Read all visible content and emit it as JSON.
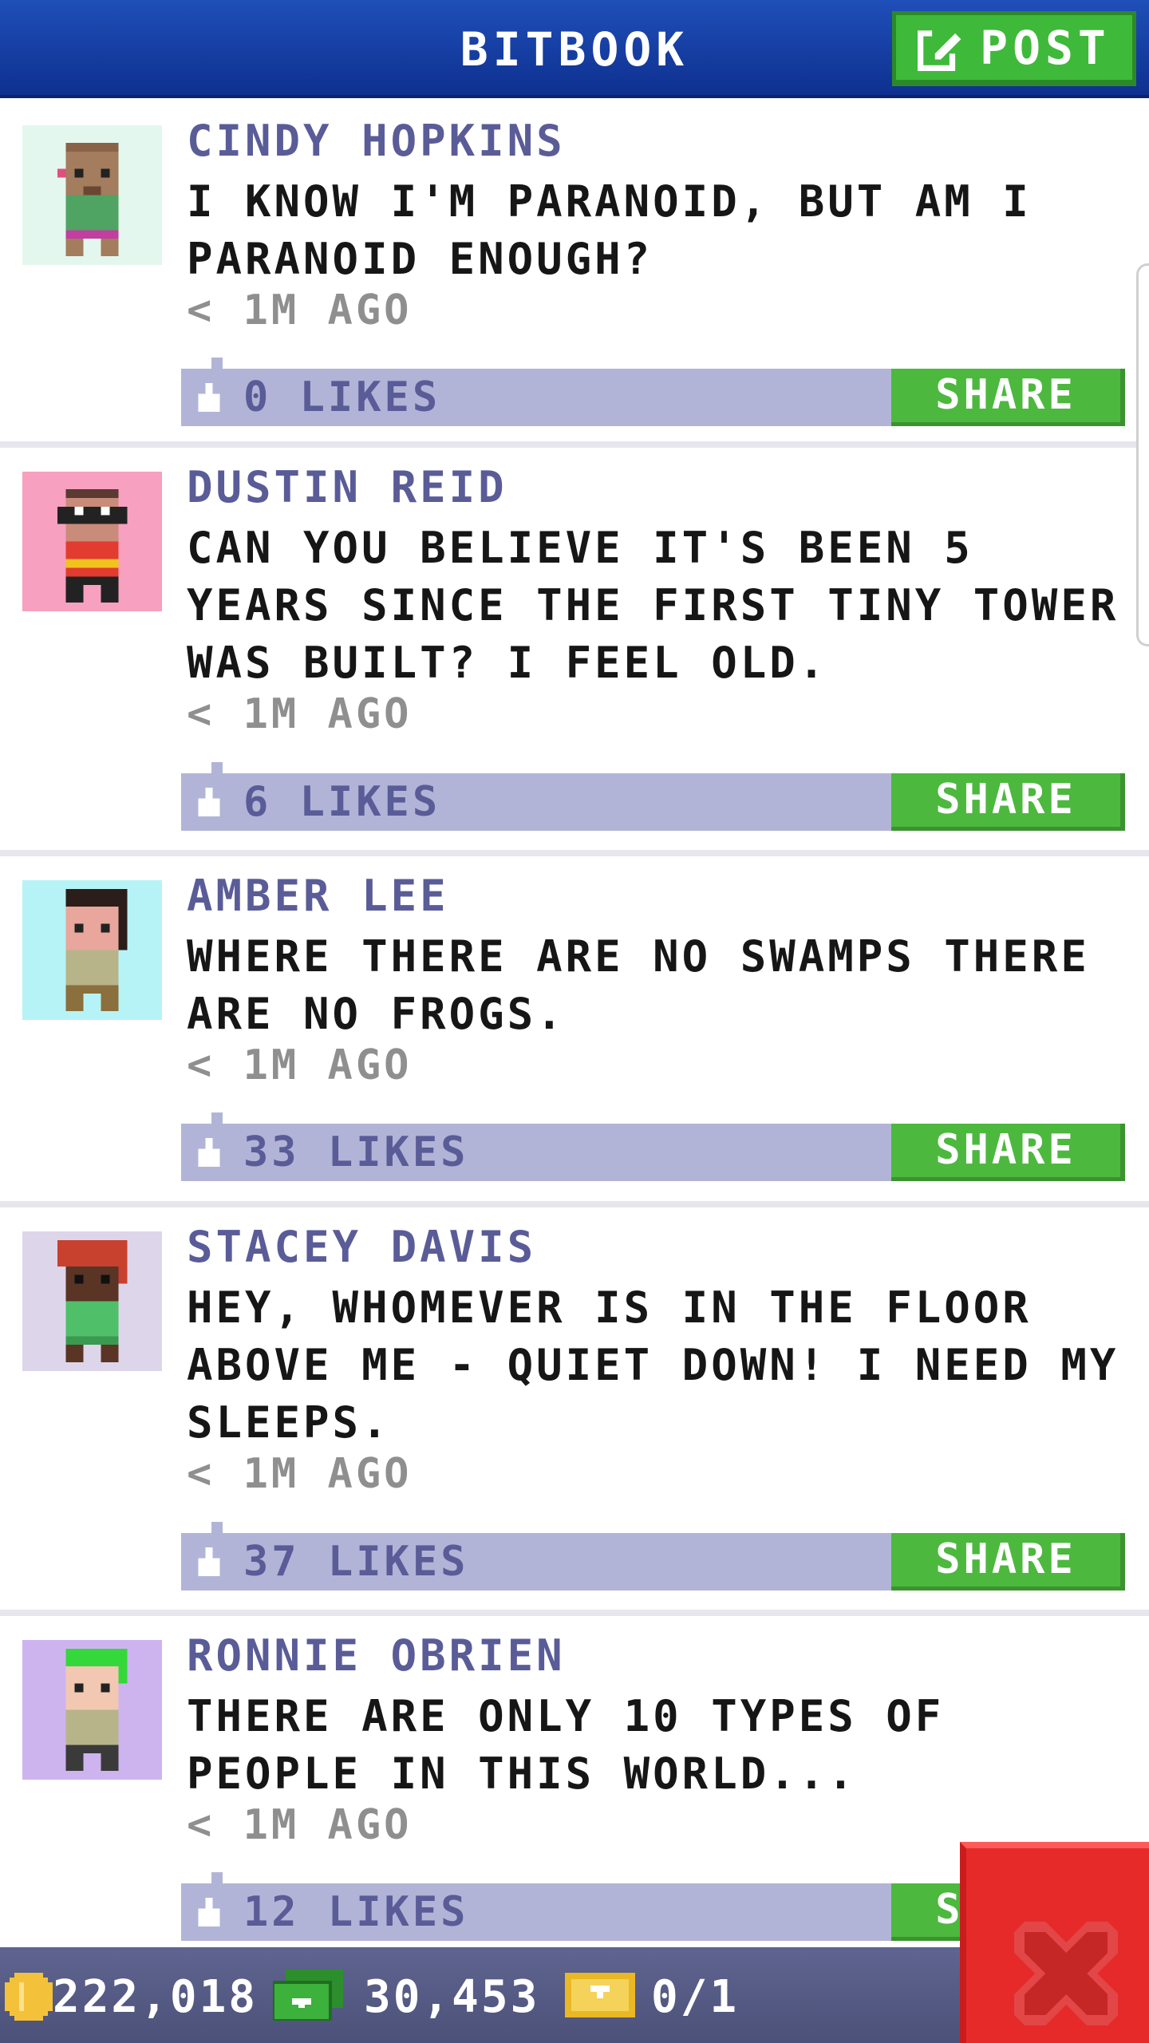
{
  "header": {
    "title": "BITBOOK",
    "post_label": "POST"
  },
  "colors": {
    "header": "#1a45a8",
    "accent_green": "#3fb93a",
    "likes_bar": "#b2b4d7",
    "author": "#5a5c98",
    "close": "#e62a2a"
  },
  "posts": [
    {
      "author": "CINDY HOPKINS",
      "text": "I KNOW I'M PARANOID, BUT AM I PARANOID ENOUGH?",
      "time": "< 1M AGO",
      "likes": "0 LIKES",
      "share": "SHARE",
      "avatar_bg": "#e3f7ee"
    },
    {
      "author": "DUSTIN REID",
      "text": "CAN YOU BELIEVE IT'S BEEN 5 YEARS SINCE THE FIRST TINY TOWER WAS BUILT? I FEEL OLD.",
      "time": "< 1M AGO",
      "likes": "6 LIKES",
      "share": "SHARE",
      "avatar_bg": "#f7a0c0"
    },
    {
      "author": "AMBER LEE",
      "text": "WHERE THERE ARE NO SWAMPS THERE ARE NO FROGS.",
      "time": "< 1M AGO",
      "likes": "33 LIKES",
      "share": "SHARE",
      "avatar_bg": "#b6f3f6"
    },
    {
      "author": "STACEY DAVIS",
      "text": "HEY, WHOMEVER IS IN THE FLOOR ABOVE ME - QUIET DOWN! I NEED MY SLEEPS.",
      "time": "< 1M AGO",
      "likes": "37 LIKES",
      "share": "SHARE",
      "avatar_bg": "#ddd6ea"
    },
    {
      "author": "RONNIE OBRIEN",
      "text": "THERE ARE ONLY 10 TYPES OF PEOPLE IN THIS WORLD...",
      "time": "< 1M AGO",
      "likes": "12 LIKES",
      "share": "SHARE",
      "avatar_bg": "#cdb4ef"
    }
  ],
  "status": {
    "coins": "222,018",
    "bux": "30,453",
    "tickets": "0/1"
  },
  "icons": {
    "post": "edit-icon",
    "like": "thumbs-up-icon",
    "coin": "coin-icon",
    "bux": "bux-icon",
    "ticket": "golden-ticket-icon",
    "close": "close-icon"
  }
}
